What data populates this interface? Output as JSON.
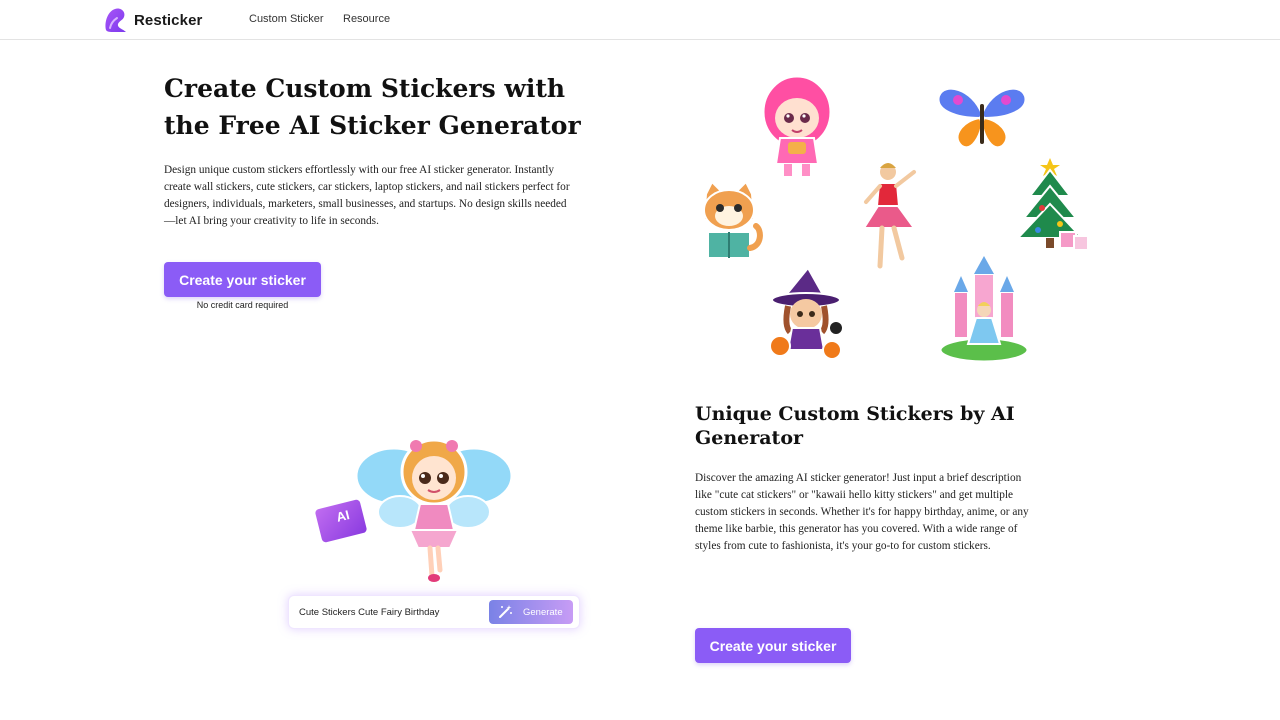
{
  "brand": {
    "name": "Resticker",
    "color": "#8b5cf6"
  },
  "nav": {
    "items": [
      "Custom Sticker",
      "Resource"
    ]
  },
  "hero": {
    "title": "Create Custom Stickers with the Free AI Sticker Generator",
    "description": "Design unique custom stickers effortlessly with our free AI sticker generator. Instantly create wall stickers, cute stickers, car stickers, laptop stickers, and nail stickers perfect for designers, individuals, marketers, small businesses, and startups. No design skills needed—let AI bring your creativity to life in seconds.",
    "cta_label": "Create your sticker",
    "cta_note": "No credit card required"
  },
  "sticker_gallery": {
    "icons": [
      "anime-girl-sticker",
      "butterfly-sticker",
      "cat-reading-sticker",
      "dancing-girl-sticker",
      "christmas-tree-sticker",
      "witch-girl-sticker",
      "princess-castle-sticker"
    ]
  },
  "feature": {
    "title": "Unique Custom Stickers by AI Generator",
    "description": "Discover the amazing AI sticker generator! Just input a brief description like \"cute cat stickers\" or \"kawaii hello kitty stickers\" and get multiple custom stickers in seconds. Whether it's for happy birthday, anime, or any theme like barbie, this generator has you covered. With a wide range of styles from cute to fashionista, it's your go-to for custom stickers.",
    "cta_label": "Create your sticker"
  },
  "demo": {
    "badge": "AI",
    "prompt_value": "Cute Stickers Cute Fairy Birthday",
    "generate_label": "Generate",
    "illustration": "fairy-sticker"
  }
}
